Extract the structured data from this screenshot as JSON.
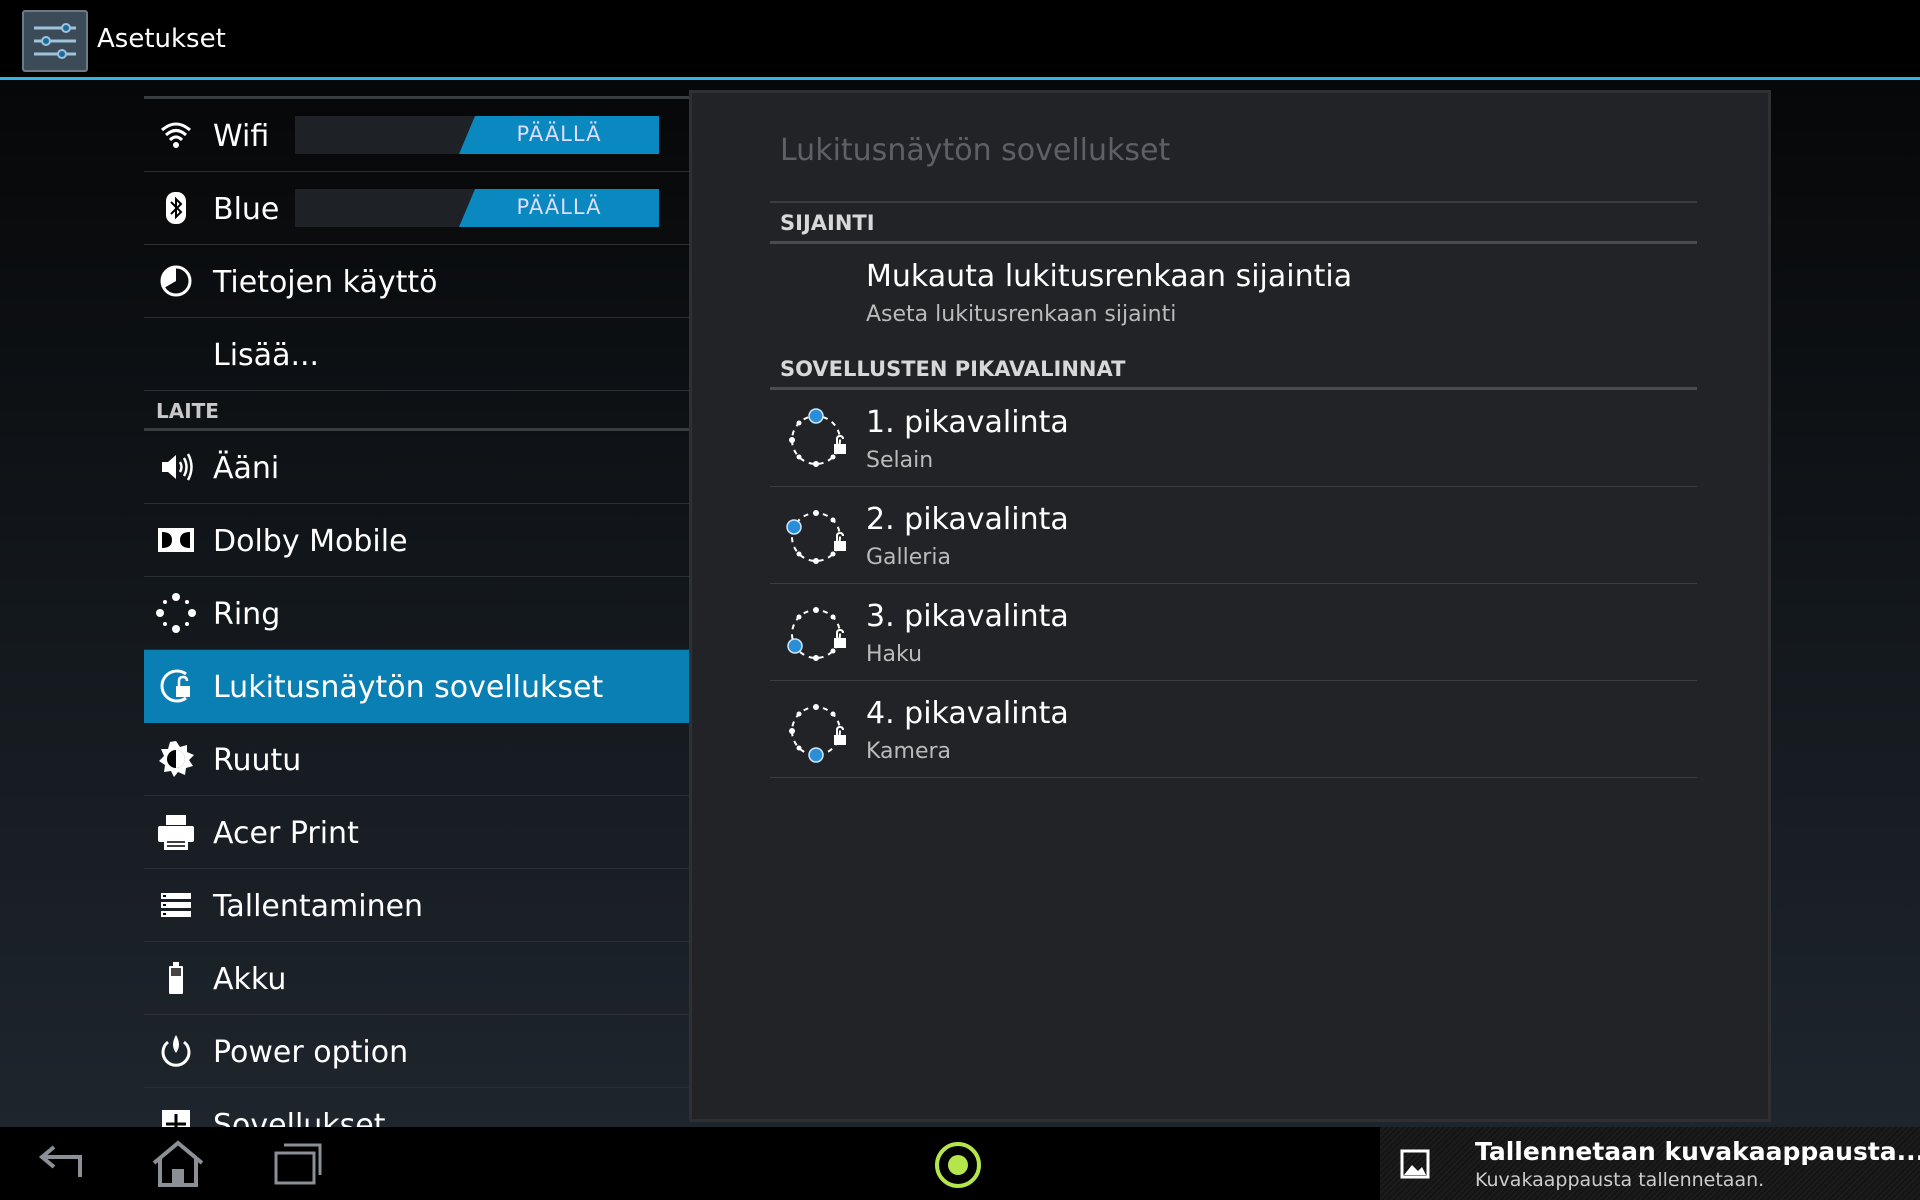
{
  "app": {
    "title": "Asetukset"
  },
  "left_list": {
    "items_top": [
      {
        "label": "Wifi",
        "toggle": "PÄÄLLÄ",
        "icon": "wifi-icon"
      },
      {
        "label": "Blue",
        "toggle": "PÄÄLLÄ",
        "icon": "bluetooth-icon"
      },
      {
        "label": "Tietojen käyttö",
        "icon": "data-usage-icon"
      },
      {
        "label": "Lisää...",
        "icon": ""
      }
    ],
    "section_device": "LAITE",
    "items_device": [
      {
        "label": "Ääni",
        "icon": "speaker-icon"
      },
      {
        "label": "Dolby Mobile",
        "icon": "dolby-icon"
      },
      {
        "label": "Ring",
        "icon": "ring-icon"
      },
      {
        "label": "Lukitusnäytön sovellukset",
        "icon": "lockscreen-apps-icon",
        "selected": true
      },
      {
        "label": "Ruutu",
        "icon": "brightness-icon"
      },
      {
        "label": "Acer Print",
        "icon": "printer-icon"
      },
      {
        "label": "Tallentaminen",
        "icon": "storage-icon"
      },
      {
        "label": "Akku",
        "icon": "battery-icon"
      },
      {
        "label": "Power option",
        "icon": "power-icon"
      },
      {
        "label": "Sovellukset",
        "icon": "apps-icon"
      }
    ]
  },
  "right_pane": {
    "title": "Lukitusnäytön sovellukset",
    "section_location": "SIJAINTI",
    "location_item": {
      "title": "Mukauta lukitusrenkaan sijaintia",
      "subtitle": "Aseta lukitusrenkaan sijainti"
    },
    "section_shortcuts": "SOVELLUSTEN PIKAVALINNAT",
    "shortcuts": [
      {
        "title": "1. pikavalinta",
        "subtitle": "Selain"
      },
      {
        "title": "2. pikavalinta",
        "subtitle": "Galleria"
      },
      {
        "title": "3. pikavalinta",
        "subtitle": "Haku"
      },
      {
        "title": "4. pikavalinta",
        "subtitle": "Kamera"
      }
    ]
  },
  "notification": {
    "title": "Tallennetaan kuvakaappausta...",
    "subtitle": "Kuvakaappausta tallennetaan."
  },
  "colors": {
    "accent": "#33b5e5",
    "selected": "#0a7fb4",
    "toggle_on": "#0a88c0",
    "home_ring": "#b4e54a"
  }
}
